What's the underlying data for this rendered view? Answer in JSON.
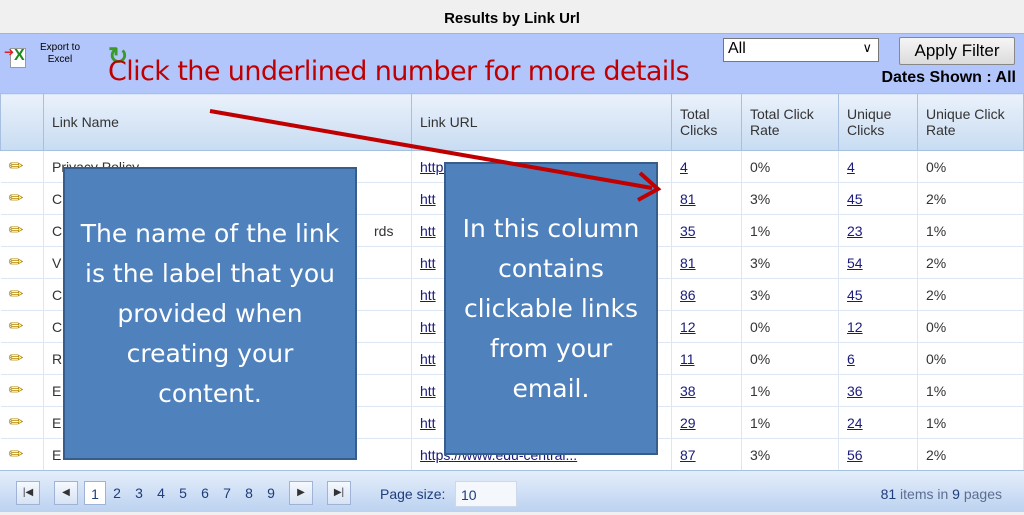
{
  "title": "Results by Link Url",
  "toolbar": {
    "export_label": "Export to Excel",
    "filter_value": "All",
    "apply_label": "Apply Filter",
    "dates_shown": "Dates Shown : All",
    "hint": "Click the underlined number for more details"
  },
  "columns": [
    "Link Name",
    "Link URL",
    "Total Clicks",
    "Total Click Rate",
    "Unique Clicks",
    "Unique Click Rate"
  ],
  "rows": [
    {
      "name": "Privacy Policy",
      "tail": "",
      "url": "https://www.edu-central...",
      "total": "4",
      "rate": "0%",
      "unique": "4",
      "urate": "0%"
    },
    {
      "name": "C",
      "tail": "",
      "url": "htt",
      "total": "81",
      "rate": "3%",
      "unique": "45",
      "urate": "2%"
    },
    {
      "name": "C",
      "tail": "rds",
      "url": "htt",
      "total": "35",
      "rate": "1%",
      "unique": "23",
      "urate": "1%"
    },
    {
      "name": "V",
      "tail": "",
      "url": "htt",
      "total": "81",
      "rate": "3%",
      "unique": "54",
      "urate": "2%"
    },
    {
      "name": "C",
      "tail": "",
      "url": "htt",
      "total": "86",
      "rate": "3%",
      "unique": "45",
      "urate": "2%"
    },
    {
      "name": "C",
      "tail": "",
      "url": "htt",
      "total": "12",
      "rate": "0%",
      "unique": "12",
      "urate": "0%"
    },
    {
      "name": "R",
      "tail": "",
      "url": "htt",
      "total": "11",
      "rate": "0%",
      "unique": "6",
      "urate": "0%"
    },
    {
      "name": "E",
      "tail": "",
      "url": "htt",
      "total": "38",
      "rate": "1%",
      "unique": "36",
      "urate": "1%"
    },
    {
      "name": "E",
      "tail": "",
      "url": "htt",
      "total": "29",
      "rate": "1%",
      "unique": "24",
      "urate": "1%"
    },
    {
      "name": "E",
      "tail": "",
      "url": "https://www.edu-central...",
      "total": "87",
      "rate": "3%",
      "unique": "56",
      "urate": "2%"
    }
  ],
  "pager": {
    "pages": [
      "1",
      "2",
      "3",
      "4",
      "5",
      "6",
      "7",
      "8",
      "9"
    ],
    "current": "1",
    "page_size_label": "Page size:",
    "page_size": "10",
    "items": "81",
    "items_mid": " items in ",
    "page_count": "9",
    "pages_suffix": " pages"
  },
  "callouts": {
    "left": "The name of the link is the label that you provided when creating your content.",
    "right": "In this column contains clickable links from your email."
  },
  "colors": {
    "callout": "#4f81bd",
    "hint": "#c00000",
    "toolbar": "#b3c6fb"
  }
}
